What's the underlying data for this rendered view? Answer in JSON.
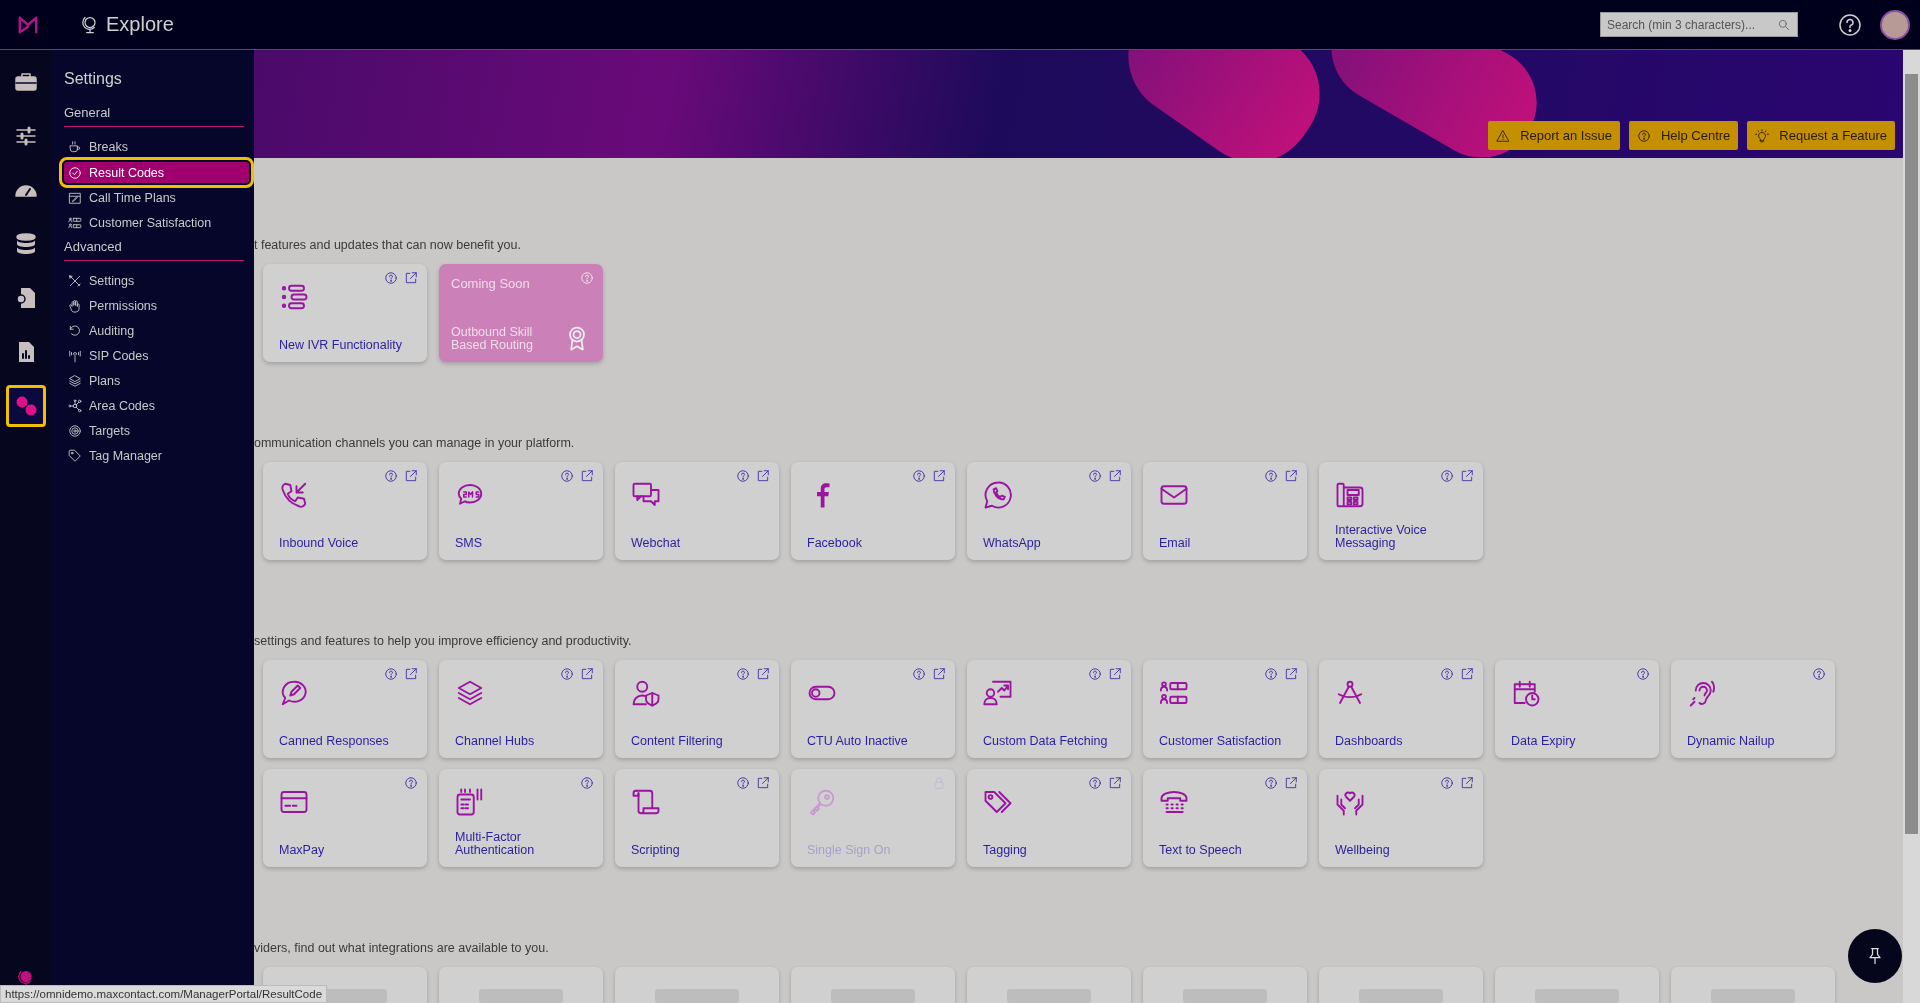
{
  "topbar": {
    "title": "Explore",
    "search": {
      "placeholder": "Search (min 3 characters)..."
    }
  },
  "rail": {
    "items": [
      {
        "selected": false
      },
      {
        "selected": false
      },
      {
        "selected": false
      },
      {
        "selected": false
      },
      {
        "selected": false
      },
      {
        "selected": false
      },
      {
        "selected": true
      }
    ]
  },
  "settings_menu": {
    "title": "Settings",
    "groups": [
      {
        "heading": "General",
        "items": [
          {
            "label": "Breaks",
            "selected": false
          },
          {
            "label": "Result Codes",
            "selected": true
          },
          {
            "label": "Call Time Plans",
            "selected": false
          },
          {
            "label": "Customer Satisfaction",
            "selected": false
          }
        ]
      },
      {
        "heading": "Advanced",
        "items": [
          {
            "label": "Settings",
            "selected": false
          },
          {
            "label": "Permissions",
            "selected": false
          },
          {
            "label": "Auditing",
            "selected": false
          },
          {
            "label": "SIP Codes",
            "selected": false
          },
          {
            "label": "Plans",
            "selected": false
          },
          {
            "label": "Area Codes",
            "selected": false
          },
          {
            "label": "Targets",
            "selected": false
          },
          {
            "label": "Tag Manager",
            "selected": false
          }
        ]
      }
    ]
  },
  "banner": {
    "buttons": [
      "Report an Issue",
      "Help Centre",
      "Request a Feature"
    ]
  },
  "sections": [
    {
      "description": "t features and updates that can now benefit you.",
      "cards": [
        {
          "kind": "feature",
          "label": "New IVR Functionality",
          "help": true,
          "external": true,
          "locked": false,
          "disabled": false
        },
        {
          "kind": "coming_soon",
          "badge": "Coming Soon",
          "label": "Outbound Skill Based Routing",
          "help": true,
          "external": false,
          "locked": false,
          "disabled": false
        }
      ]
    },
    {
      "description": "ommunication channels you can manage in your platform.",
      "cards": [
        {
          "kind": "feature",
          "label": "Inbound Voice",
          "help": true,
          "external": true,
          "locked": false,
          "disabled": false
        },
        {
          "kind": "feature",
          "label": "SMS",
          "help": true,
          "external": true,
          "locked": false,
          "disabled": false
        },
        {
          "kind": "feature",
          "label": "Webchat",
          "help": true,
          "external": true,
          "locked": false,
          "disabled": false
        },
        {
          "kind": "feature",
          "label": "Facebook",
          "help": true,
          "external": true,
          "locked": false,
          "disabled": false
        },
        {
          "kind": "feature",
          "label": "WhatsApp",
          "help": true,
          "external": true,
          "locked": false,
          "disabled": false
        },
        {
          "kind": "feature",
          "label": "Email",
          "help": true,
          "external": true,
          "locked": false,
          "disabled": false
        },
        {
          "kind": "feature",
          "label": "Interactive Voice Messaging",
          "help": true,
          "external": true,
          "locked": false,
          "disabled": false
        }
      ]
    },
    {
      "description": "settings and features to help you improve efficiency and productivity.",
      "cards": [
        {
          "kind": "feature",
          "label": "Canned Responses",
          "help": true,
          "external": true,
          "locked": false,
          "disabled": false
        },
        {
          "kind": "feature",
          "label": "Channel Hubs",
          "help": true,
          "external": true,
          "locked": false,
          "disabled": false
        },
        {
          "kind": "feature",
          "label": "Content Filtering",
          "help": true,
          "external": true,
          "locked": false,
          "disabled": false
        },
        {
          "kind": "feature",
          "label": "CTU Auto Inactive",
          "help": true,
          "external": true,
          "locked": false,
          "disabled": false
        },
        {
          "kind": "feature",
          "label": "Custom Data Fetching",
          "help": true,
          "external": true,
          "locked": false,
          "disabled": false
        },
        {
          "kind": "feature",
          "label": "Customer Satisfaction",
          "help": true,
          "external": true,
          "locked": false,
          "disabled": false
        },
        {
          "kind": "feature",
          "label": "Dashboards",
          "help": true,
          "external": true,
          "locked": false,
          "disabled": false
        },
        {
          "kind": "feature",
          "label": "Data Expiry",
          "help": true,
          "external": false,
          "locked": false,
          "disabled": false
        },
        {
          "kind": "feature",
          "label": "Dynamic Nailup",
          "help": true,
          "external": false,
          "locked": false,
          "disabled": false
        },
        {
          "kind": "feature",
          "label": "MaxPay",
          "help": true,
          "external": false,
          "locked": false,
          "disabled": false
        },
        {
          "kind": "feature",
          "label": "Multi-Factor Authentication",
          "help": true,
          "external": false,
          "locked": false,
          "disabled": false
        },
        {
          "kind": "feature",
          "label": "Scripting",
          "help": true,
          "external": true,
          "locked": false,
          "disabled": false
        },
        {
          "kind": "feature",
          "label": "Single Sign On",
          "help": false,
          "external": false,
          "locked": true,
          "disabled": true
        },
        {
          "kind": "feature",
          "label": "Tagging",
          "help": true,
          "external": true,
          "locked": false,
          "disabled": false
        },
        {
          "kind": "feature",
          "label": "Text to Speech",
          "help": true,
          "external": true,
          "locked": false,
          "disabled": false
        },
        {
          "kind": "feature",
          "label": "Wellbeing",
          "help": true,
          "external": true,
          "locked": false,
          "disabled": false
        }
      ]
    },
    {
      "description": "viders, find out what integrations are available to you.",
      "cards": [
        {
          "kind": "integration"
        },
        {
          "kind": "integration"
        },
        {
          "kind": "integration"
        },
        {
          "kind": "integration"
        },
        {
          "kind": "integration"
        },
        {
          "kind": "integration"
        },
        {
          "kind": "integration"
        },
        {
          "kind": "integration"
        },
        {
          "kind": "integration"
        }
      ]
    }
  ],
  "status_bar": {
    "url": "https://omnidemo.maxcontact.com/ManagerPortal/ResultCode"
  }
}
